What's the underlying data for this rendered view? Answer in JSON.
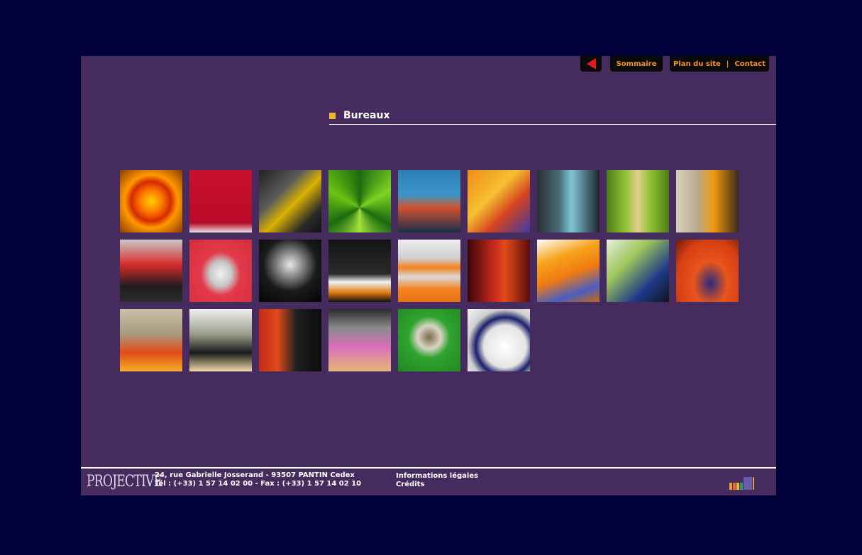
{
  "nav": {
    "back_label": "",
    "sommaire": "Sommaire",
    "plan_du_site": "Plan du site",
    "separator": "|",
    "contact": "Contact"
  },
  "page": {
    "title": "Bureaux"
  },
  "gallery": {
    "count": 24,
    "rows": [
      9,
      9,
      6
    ]
  },
  "footer": {
    "logo": "PROJECTIVE",
    "address_line1": "24, rue Gabrielle Josserand - 93507 PANTIN Cedex",
    "address_line2": "Tél : (+33) 1 57 14 02 00 - Fax : (+33) 1 57 14 02 10",
    "legal": "Informations légales",
    "credits": "Crédits"
  },
  "colors": {
    "background": "#02003a",
    "frame": "#452b5e",
    "accent": "#f7931e",
    "bullet": "#f5b52a",
    "back_arrow": "#e0191b"
  }
}
